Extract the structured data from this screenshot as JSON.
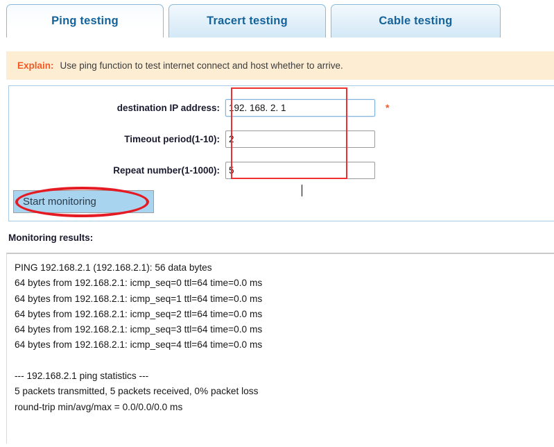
{
  "tabs": [
    {
      "label": "Ping testing",
      "active": true
    },
    {
      "label": "Tracert testing",
      "active": false
    },
    {
      "label": "Cable testing",
      "active": false
    }
  ],
  "explain": {
    "label": "Explain:",
    "text": "Use ping function to test internet connect and host whether to arrive."
  },
  "form": {
    "fields": [
      {
        "label": "destination IP address:",
        "value": "192. 168. 2. 1",
        "required_marker": "*",
        "focused": true
      },
      {
        "label": "Timeout period(1-10):",
        "value": "2",
        "required_marker": "",
        "focused": false
      },
      {
        "label": "Repeat number(1-1000):",
        "value": "5",
        "required_marker": "",
        "focused": false
      }
    ],
    "start_button_label": "Start monitoring"
  },
  "results": {
    "title": "Monitoring results:",
    "lines": [
      "PING 192.168.2.1 (192.168.2.1): 56 data bytes",
      "64 bytes from 192.168.2.1: icmp_seq=0 ttl=64 time=0.0 ms",
      "64 bytes from 192.168.2.1: icmp_seq=1 ttl=64 time=0.0 ms",
      "64 bytes from 192.168.2.1: icmp_seq=2 ttl=64 time=0.0 ms",
      "64 bytes from 192.168.2.1: icmp_seq=3 ttl=64 time=0.0 ms",
      "64 bytes from 192.168.2.1: icmp_seq=4 ttl=64 time=0.0 ms",
      "",
      "--- 192.168.2.1 ping statistics ---",
      "5 packets transmitted, 5 packets received, 0% packet loss",
      "round-trip min/avg/max = 0.0/0.0/0.0 ms"
    ]
  },
  "colors": {
    "tab_text": "#14639b",
    "explain_label": "#f15a24",
    "explain_bg": "#fdeed3",
    "annotation_red": "#e51b23",
    "button_bg": "#a8d4f0"
  }
}
